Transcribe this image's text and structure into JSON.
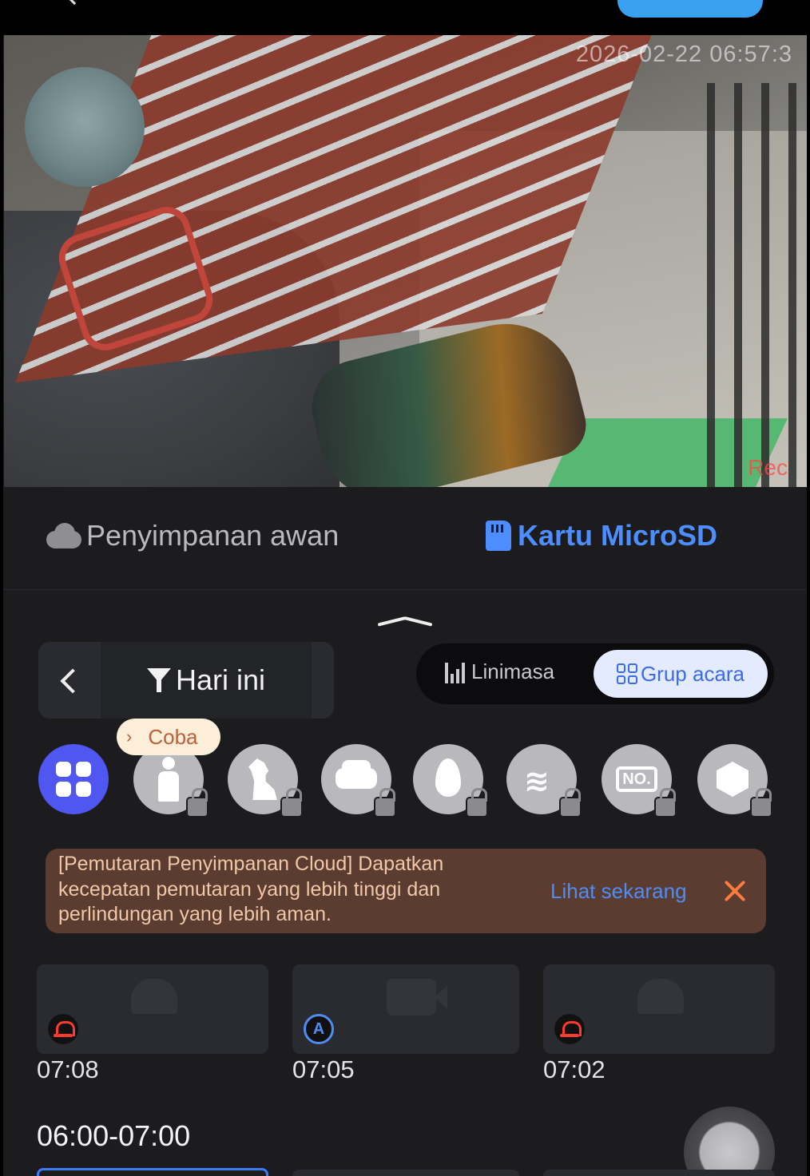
{
  "video": {
    "timestamp": "2026-02-22 06:57:3",
    "rec_label": "Rec"
  },
  "storage_tabs": {
    "cloud_label": "Penyimpanan awan",
    "sd_label": "Kartu MicroSD",
    "active": "sd"
  },
  "date_filter": {
    "label": "Hari ini"
  },
  "view_toggle": {
    "timeline_label": "Linimasa",
    "group_label": "Grup acara",
    "active": "group"
  },
  "tooltip": {
    "label": "Coba"
  },
  "categories": [
    {
      "icon": "all-grid-icon",
      "selected": true,
      "locked": false
    },
    {
      "icon": "person-icon",
      "locked": true
    },
    {
      "icon": "pet-icon",
      "locked": true
    },
    {
      "icon": "vehicle-icon",
      "locked": true
    },
    {
      "icon": "fire-icon",
      "locked": true
    },
    {
      "icon": "smoke-icon",
      "locked": true
    },
    {
      "icon": "license-plate-icon",
      "text": "NO.",
      "locked": true
    },
    {
      "icon": "package-icon",
      "locked": true
    }
  ],
  "promo": {
    "text": "[Pemutaran Penyimpanan Cloud] Dapatkan kecepatan pemutaran yang lebih tinggi dan perlindungan yang lebih aman.",
    "link": "Lihat sekarang",
    "accent_color": "#ff7a3d"
  },
  "events": [
    {
      "time": "07:08",
      "type": "alarm-icon"
    },
    {
      "time": "07:05",
      "type": "auto-record-icon",
      "badge": "A"
    },
    {
      "time": "07:02",
      "type": "alarm-icon"
    }
  ],
  "hour_group": {
    "label": "06:00-07:00"
  },
  "colors": {
    "accent_blue": "#4d8dff",
    "category_selected": "#4f57f0",
    "alarm_red": "#ff3b30",
    "promo_bg": "#5b3c31"
  }
}
